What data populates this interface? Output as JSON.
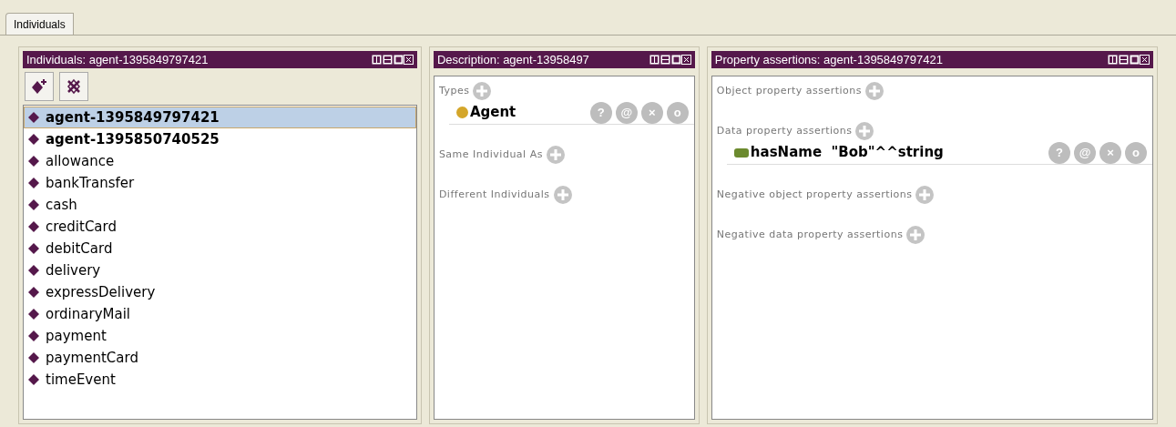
{
  "tabs": [
    {
      "label": "Individuals",
      "selected": true
    }
  ],
  "individuals_panel": {
    "title": "Individuals: agent-1395849797421",
    "items": [
      {
        "label": "agent-1395849797421",
        "bold": true,
        "selected": true
      },
      {
        "label": "agent-1395850740525",
        "bold": true,
        "selected": false
      },
      {
        "label": "allowance",
        "bold": false,
        "selected": false
      },
      {
        "label": "bankTransfer",
        "bold": false,
        "selected": false
      },
      {
        "label": "cash",
        "bold": false,
        "selected": false
      },
      {
        "label": "creditCard",
        "bold": false,
        "selected": false
      },
      {
        "label": "debitCard",
        "bold": false,
        "selected": false
      },
      {
        "label": "delivery",
        "bold": false,
        "selected": false
      },
      {
        "label": "expressDelivery",
        "bold": false,
        "selected": false
      },
      {
        "label": "ordinaryMail",
        "bold": false,
        "selected": false
      },
      {
        "label": "payment",
        "bold": false,
        "selected": false
      },
      {
        "label": "paymentCard",
        "bold": false,
        "selected": false
      },
      {
        "label": "timeEvent",
        "bold": false,
        "selected": false
      }
    ]
  },
  "description_panel": {
    "title": "Description: agent-13958497",
    "sections": [
      {
        "label": "Types",
        "entries": [
          {
            "kind": "class",
            "label": "Agent",
            "actions": [
              "?",
              "@",
              "×",
              "o"
            ]
          }
        ]
      },
      {
        "label": "Same Individual As"
      },
      {
        "label": "Different Individuals"
      }
    ]
  },
  "property_panel": {
    "title": "Property assertions: agent-1395849797421",
    "sections": [
      {
        "label": "Object property assertions"
      },
      {
        "label": "Data property assertions",
        "entries": [
          {
            "kind": "data",
            "label": "hasName  \"Bob\"^^string",
            "actions": [
              "?",
              "@",
              "×",
              "o"
            ]
          }
        ]
      },
      {
        "label": "Negative object property assertions"
      },
      {
        "label": "Negative data property assertions"
      }
    ]
  }
}
